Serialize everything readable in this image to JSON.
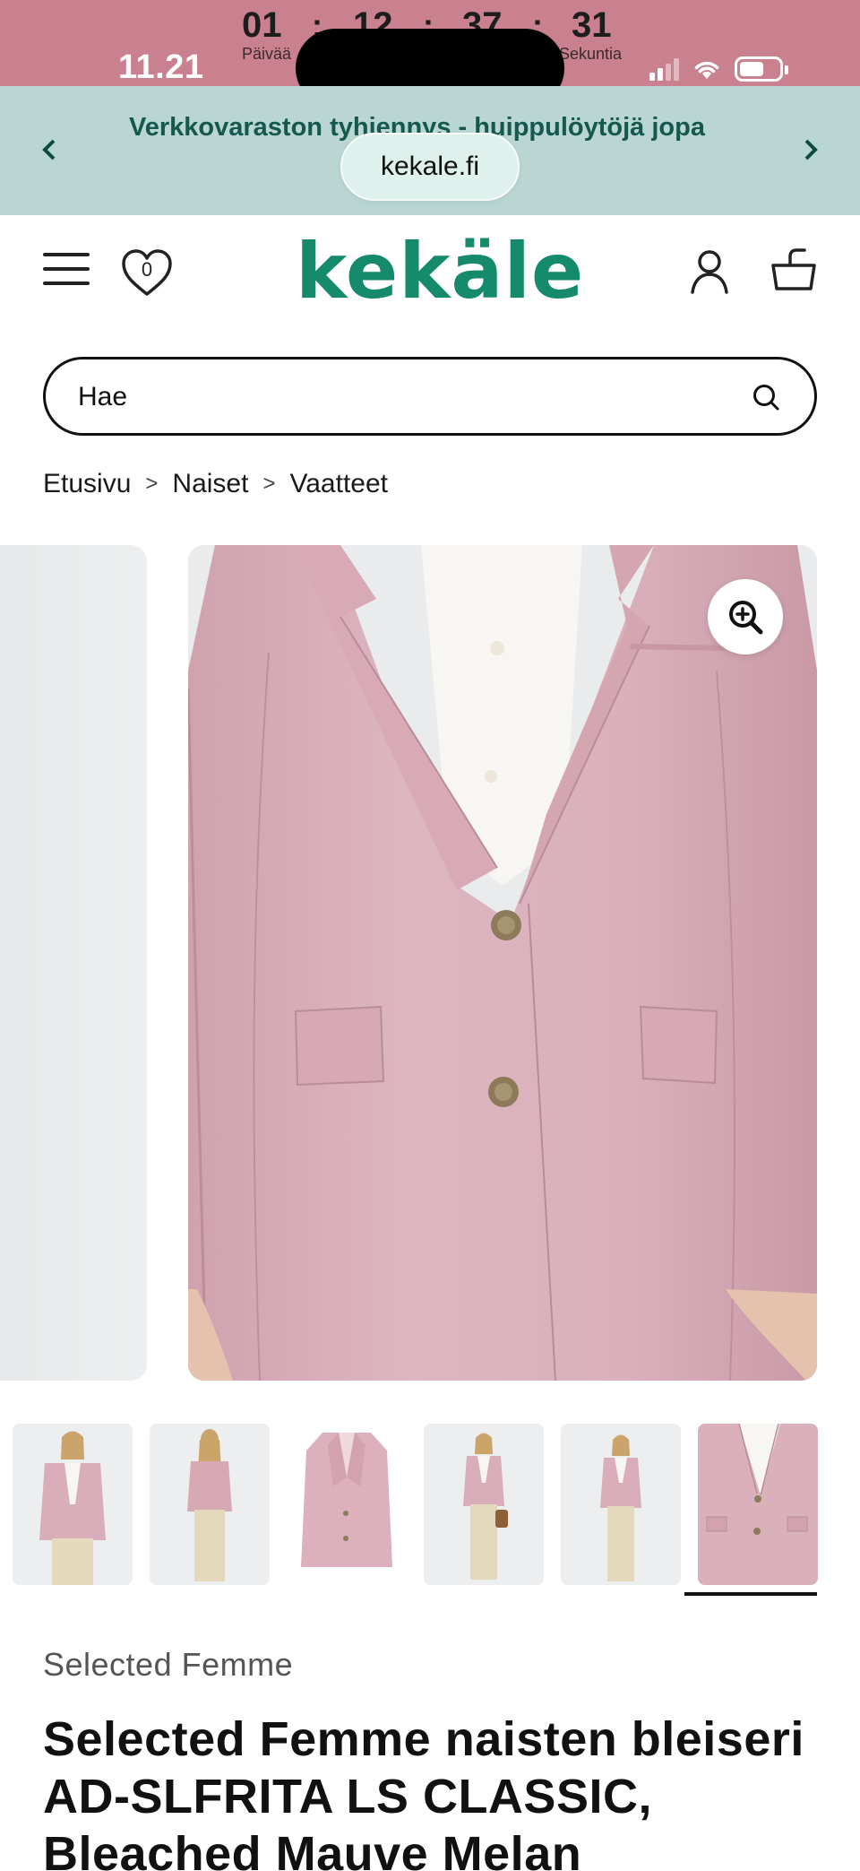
{
  "status_bar": {
    "time": "11.21",
    "countdown": {
      "days": "01",
      "days_label": "Päivää",
      "hours": "12",
      "minutes": "37",
      "seconds": "31",
      "seconds_label": "Sekuntia"
    }
  },
  "announcement": {
    "text": "Verkkovaraston tyhjennys - huippulöytöjä jopa",
    "prev_icon": "chevron-left-icon",
    "next_icon": "chevron-right-icon"
  },
  "browser": {
    "url": "kekale.fi"
  },
  "header": {
    "logo": "kekäle",
    "wishlist_count": "0",
    "icons": [
      "menu-icon",
      "heart-icon",
      "user-icon",
      "basket-icon"
    ]
  },
  "search": {
    "placeholder": "Hae"
  },
  "breadcrumb": {
    "items": [
      {
        "label": "Etusivu"
      },
      {
        "label": "Naiset"
      },
      {
        "label": "Vaatteet"
      }
    ],
    "separator": ">"
  },
  "gallery": {
    "thumbnail_count": 6,
    "active_thumbnail": 6,
    "product_color": "#dcb3bf"
  },
  "product": {
    "brand": "Selected Femme",
    "title": "Selected Femme naisten bleiseri AD-SLFRITA LS CLASSIC, Bleached Mauve Melan"
  },
  "colors": {
    "status_bar": "#c9818f",
    "banner": "#b9d6d2",
    "banner_text": "#15584e",
    "brand_green": "#168b6c"
  }
}
